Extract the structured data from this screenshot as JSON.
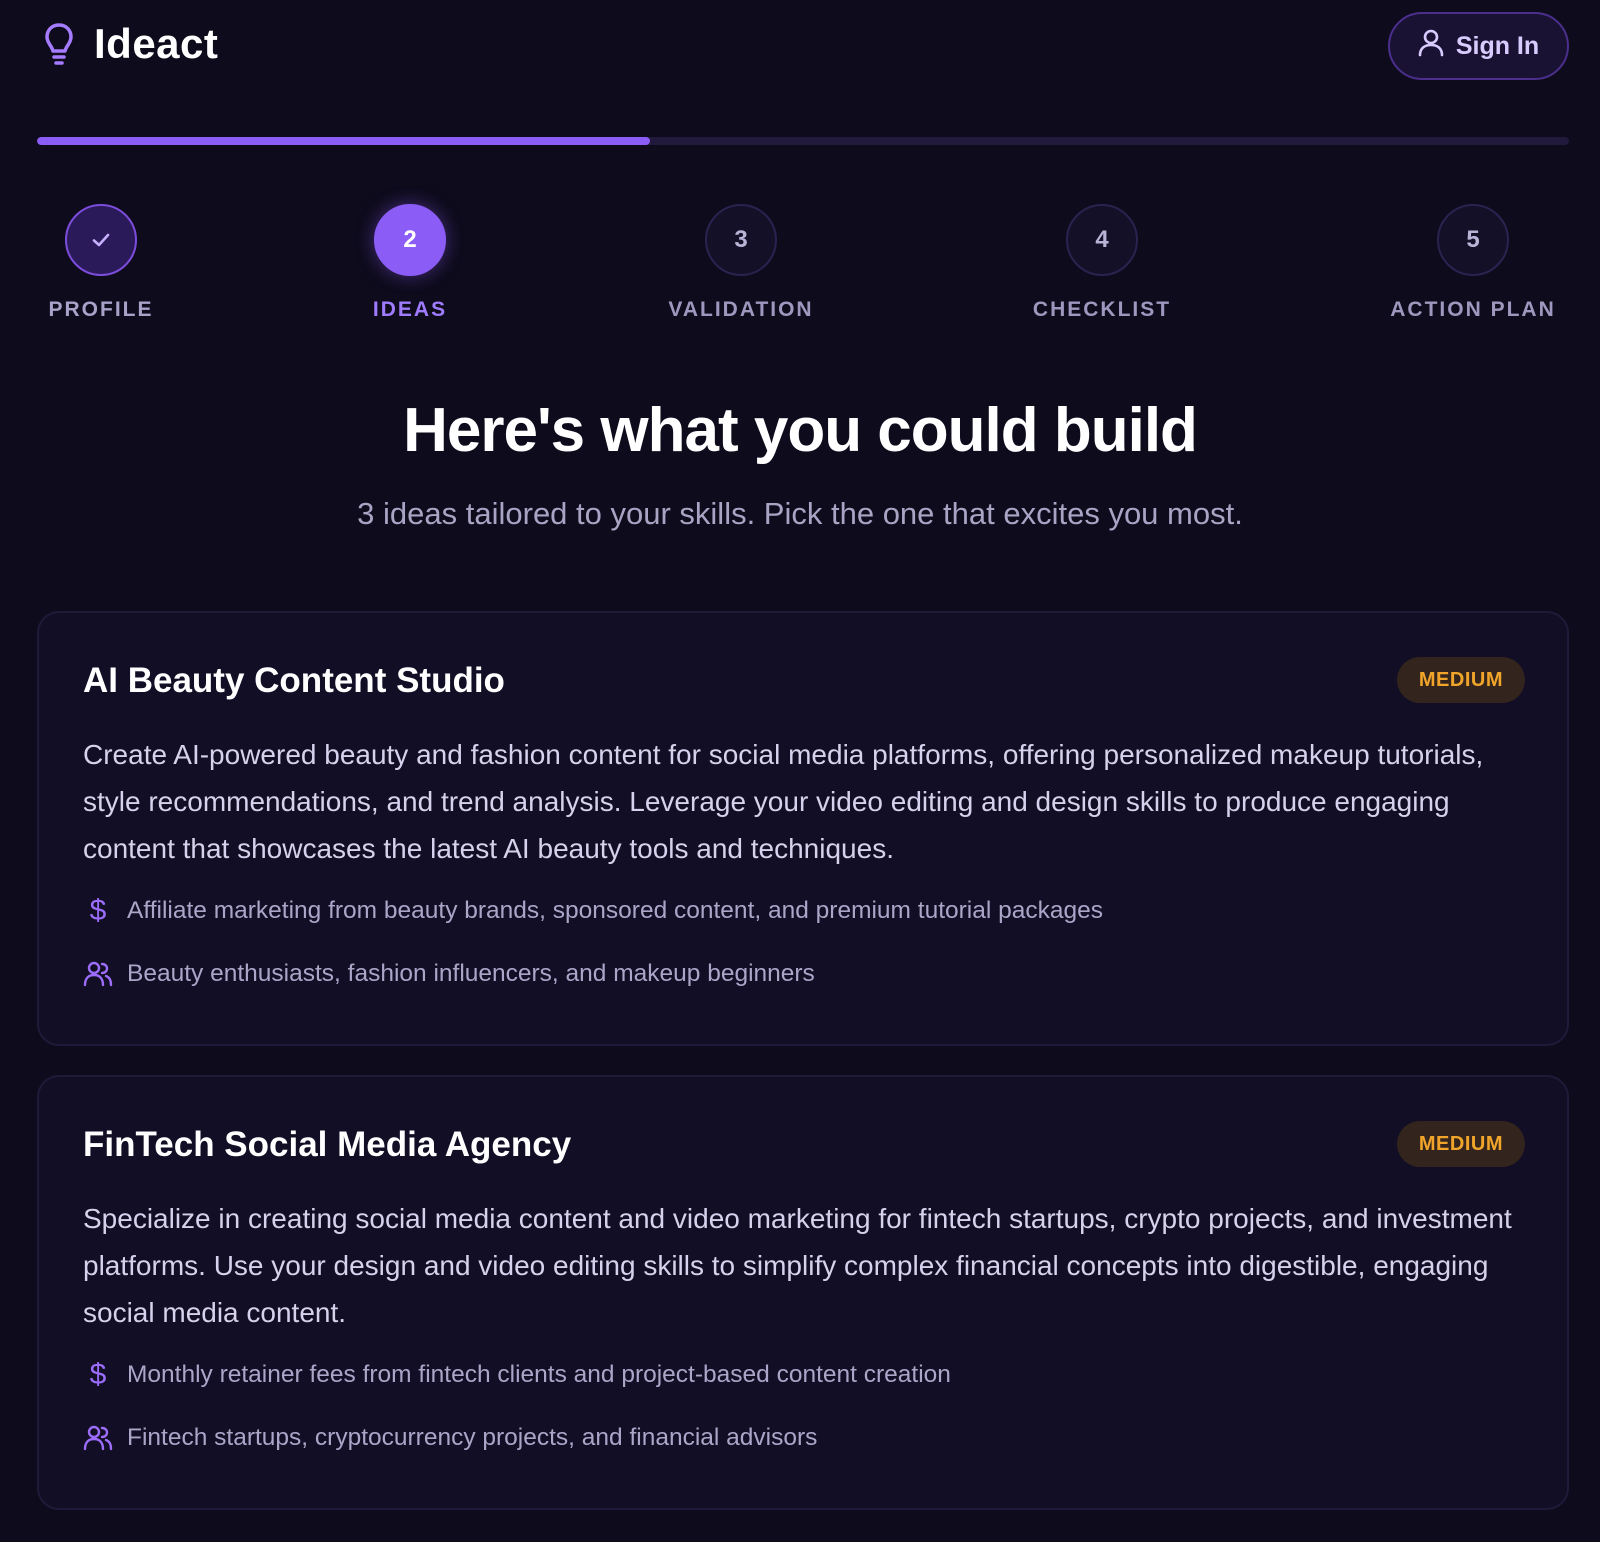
{
  "app": {
    "name": "Ideact",
    "sign_in_label": "Sign In"
  },
  "progress": {
    "fraction": 0.4
  },
  "steps": [
    {
      "number": "✓",
      "label": "PROFILE",
      "state": "done"
    },
    {
      "number": "2",
      "label": "IDEAS",
      "state": "active"
    },
    {
      "number": "3",
      "label": "VALIDATION",
      "state": "pending"
    },
    {
      "number": "4",
      "label": "CHECKLIST",
      "state": "pending"
    },
    {
      "number": "5",
      "label": "ACTION PLAN",
      "state": "pending"
    }
  ],
  "hero": {
    "title": "Here's what you could build",
    "subtitle": "3 ideas tailored to your skills. Pick the one that excites you most."
  },
  "ideas": [
    {
      "title": "AI Beauty Content Studio",
      "difficulty": "MEDIUM",
      "description": "Create AI-powered beauty and fashion content for social media platforms, offering personalized makeup tutorials, style recommendations, and trend analysis. Leverage your video editing and design skills to produce engaging content that showcases the latest AI beauty tools and techniques.",
      "revenue": "Affiliate marketing from beauty brands, sponsored content, and premium tutorial packages",
      "audience": "Beauty enthusiasts, fashion influencers, and makeup beginners"
    },
    {
      "title": "FinTech Social Media Agency",
      "difficulty": "MEDIUM",
      "description": "Specialize in creating social media content and video marketing for fintech startups, crypto projects, and investment platforms. Use your design and video editing skills to simplify complex financial concepts into digestible, engaging social media content.",
      "revenue": "Monthly retainer fees from fintech clients and project-based content creation",
      "audience": "Fintech startups, cryptocurrency projects, and financial advisors"
    }
  ],
  "colors": {
    "background": "#0e0b1c",
    "accent": "#8b5cf6",
    "card": "#120e25",
    "badge_text": "#f0a52a"
  }
}
